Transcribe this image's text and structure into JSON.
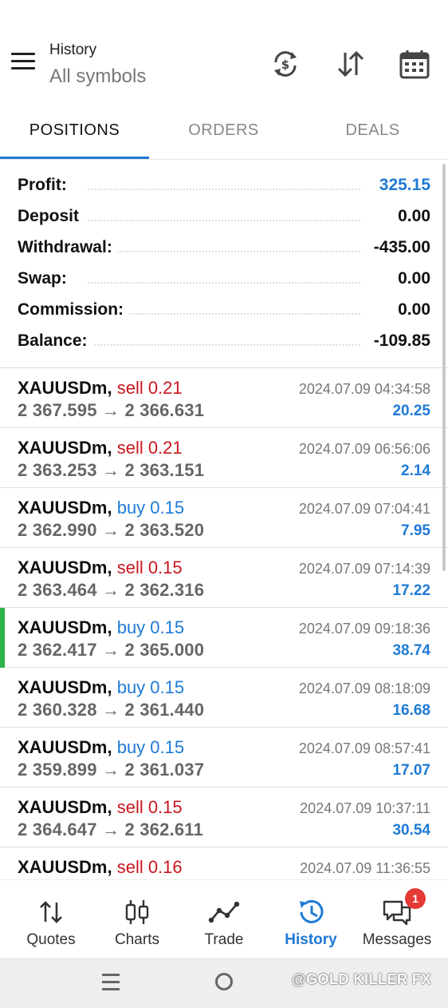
{
  "header": {
    "title": "History",
    "subtitle": "All symbols",
    "icons": [
      "menu-icon",
      "refresh-money-icon",
      "sort-icon",
      "calendar-icon"
    ]
  },
  "tabs": [
    {
      "label": "POSITIONS",
      "active": true
    },
    {
      "label": "ORDERS",
      "active": false
    },
    {
      "label": "DEALS",
      "active": false
    }
  ],
  "summary": [
    {
      "label": "Profit:",
      "value": "325.15"
    },
    {
      "label": "Deposit",
      "value": "0.00"
    },
    {
      "label": "Withdrawal:",
      "value": "-435.00"
    },
    {
      "label": "Swap:",
      "value": "0.00"
    },
    {
      "label": "Commission:",
      "value": "0.00"
    },
    {
      "label": "Balance:",
      "value": "-109.85"
    }
  ],
  "deals": [
    {
      "symbol": "XAUUSDm,",
      "side": "sell 0.21",
      "prices": "2 367.595 → 2 366.631",
      "time": "2024.07.09 04:34:58",
      "profit": "20.25"
    },
    {
      "symbol": "XAUUSDm,",
      "side": "sell 0.21",
      "prices": "2 363.253 → 2 363.151",
      "time": "2024.07.09 06:56:06",
      "profit": "2.14"
    },
    {
      "symbol": "XAUUSDm,",
      "side": "buy 0.15",
      "prices": "2 362.990 → 2 363.520",
      "time": "2024.07.09 07:04:41",
      "profit": "7.95"
    },
    {
      "symbol": "XAUUSDm,",
      "side": "sell 0.15",
      "prices": "2 363.464 → 2 362.316",
      "time": "2024.07.09 07:14:39",
      "profit": "17.22"
    },
    {
      "symbol": "XAUUSDm,",
      "side": "buy 0.15",
      "prices": "2 362.417 → 2 365.000",
      "time": "2024.07.09 09:18:36",
      "profit": "38.74"
    },
    {
      "symbol": "XAUUSDm,",
      "side": "buy 0.15",
      "prices": "2 360.328 → 2 361.440",
      "time": "2024.07.09 08:18:09",
      "profit": "16.68"
    },
    {
      "symbol": "XAUUSDm,",
      "side": "buy 0.15",
      "prices": "2 359.899 → 2 361.037",
      "time": "2024.07.09 08:57:41",
      "profit": "17.07"
    },
    {
      "symbol": "XAUUSDm,",
      "side": "sell 0.15",
      "prices": "2 364.647 → 2 362.611",
      "time": "2024.07.09 10:37:11",
      "profit": "30.54"
    },
    {
      "symbol": "XAUUSDm,",
      "side": "sell 0.16",
      "prices": "",
      "time": "2024.07.09 11:36:55",
      "profit": ""
    }
  ],
  "bottom_nav": [
    {
      "label": "Quotes",
      "icon": "quotes-icon"
    },
    {
      "label": "Charts",
      "icon": "charts-icon"
    },
    {
      "label": "Trade",
      "icon": "trade-icon"
    },
    {
      "label": "History",
      "icon": "history-icon",
      "active": true
    },
    {
      "label": "Messages",
      "icon": "messages-icon",
      "badge": "1"
    }
  ],
  "system_bar": {
    "watermark": "@GOLD KILLER FX"
  },
  "colors": {
    "accent": "#1f7ad6",
    "sell": "#c8171e",
    "buy": "#1f7ad6",
    "marker": "#2db34a",
    "badge": "#e53935"
  }
}
